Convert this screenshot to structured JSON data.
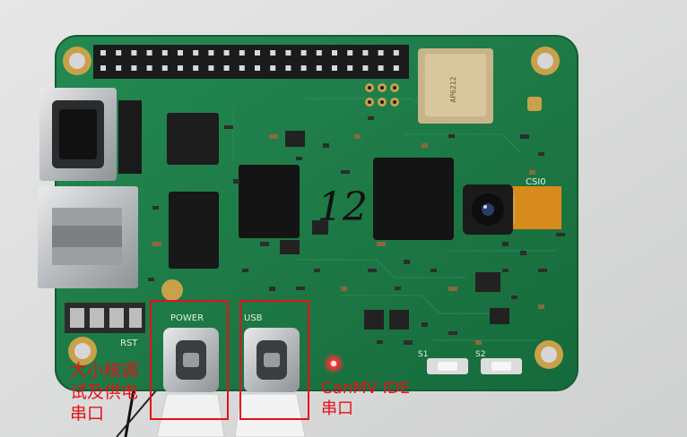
{
  "board": {
    "silkscreen_power": "POWER",
    "silkscreen_usb": "USB",
    "silkscreen_rst": "RST",
    "silkscreen_csi": "CSI0",
    "silkscreen_s1": "S1",
    "silkscreen_s2": "S2",
    "handwritten_number": "12",
    "colors": {
      "pcb": "#1f7a48",
      "highlight_box": "#e8101a",
      "led": "#ff2020"
    }
  },
  "annotations": {
    "left_label_lines": [
      "大小核调",
      "试及供电",
      "串口"
    ],
    "right_label_lines": [
      "CanMV IDE",
      "串口"
    ]
  }
}
